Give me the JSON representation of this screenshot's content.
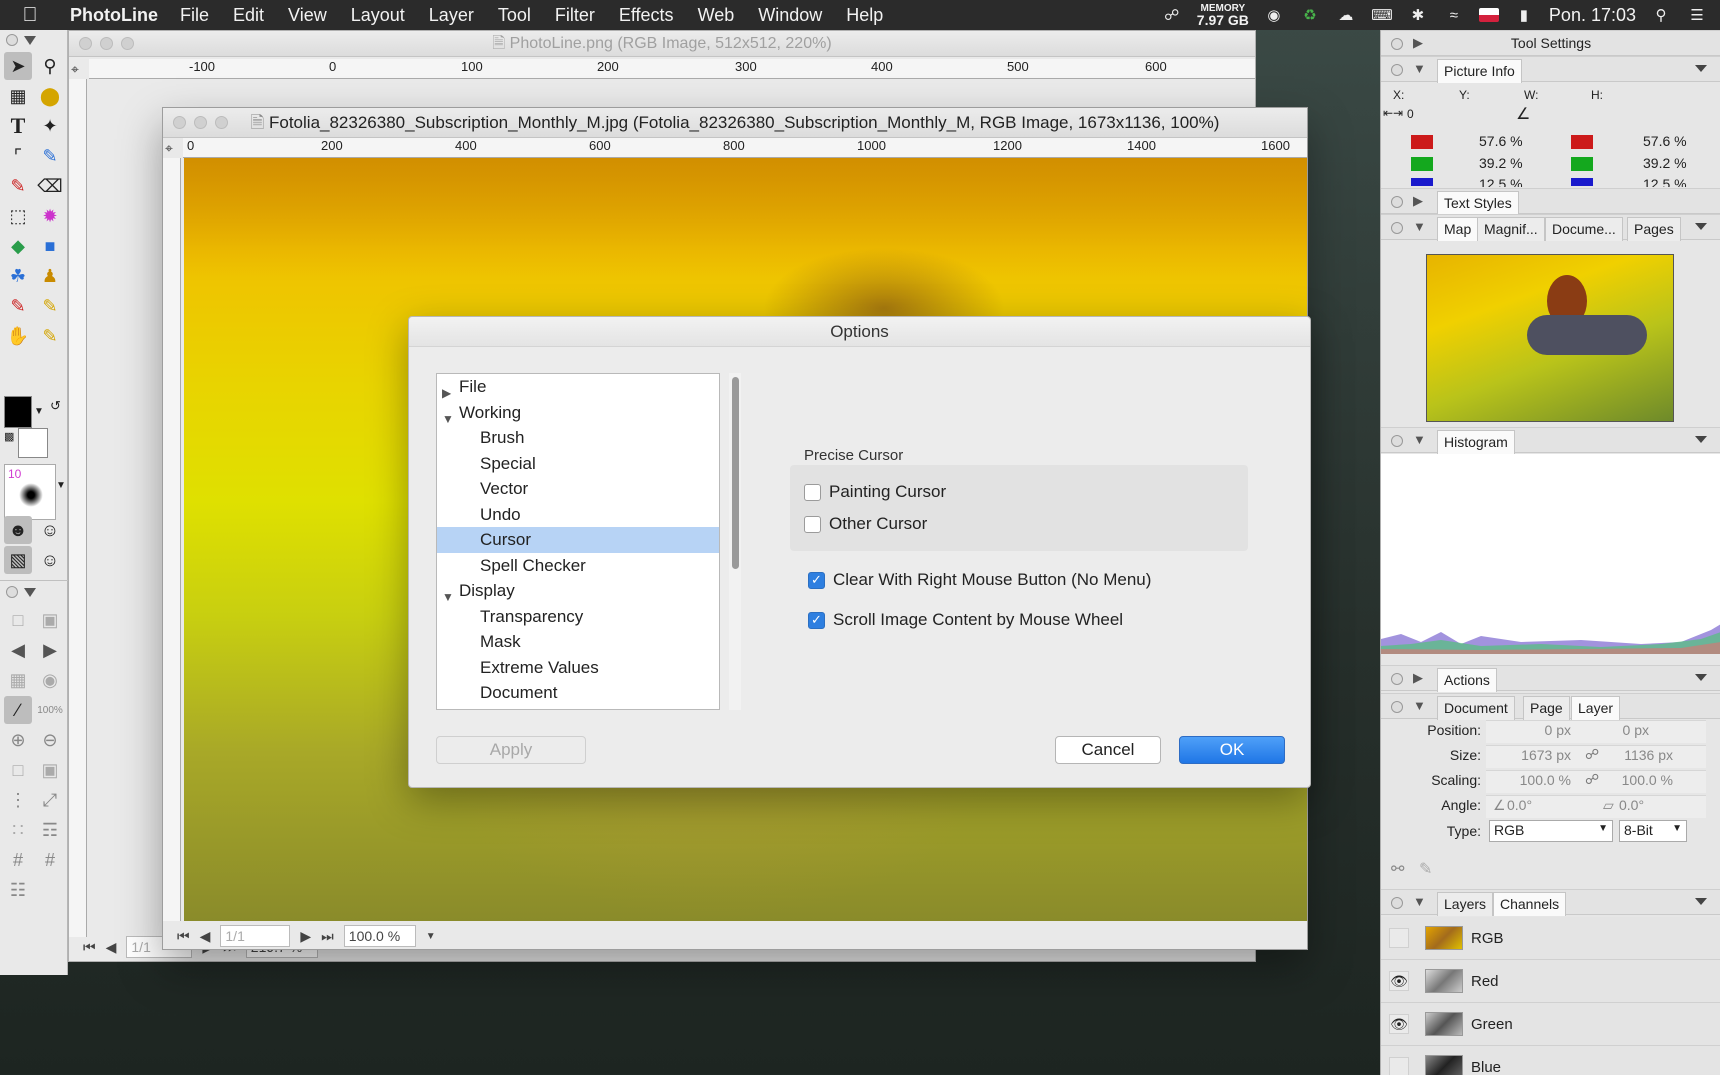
{
  "menubar": {
    "app_name": "PhotoLine",
    "items": [
      "File",
      "Edit",
      "View",
      "Layout",
      "Layer",
      "Tool",
      "Filter",
      "Effects",
      "Web",
      "Window",
      "Help"
    ],
    "memory_label": "MEMORY",
    "memory_value": "7.97 GB",
    "clock": "Pon. 17:03"
  },
  "main_window": {
    "title": "PhotoLine.png (RGB Image, 512x512, 220%)",
    "ruler_h_labels": [
      "-100",
      "0",
      "100",
      "200",
      "300",
      "400",
      "500",
      "600"
    ],
    "status_page": "1/1",
    "status_zoom": "219.7 %"
  },
  "image_window": {
    "title": "Fotolia_82326380_Subscription_Monthly_M.jpg (Fotolia_82326380_Subscription_Monthly_M, RGB Image, 1673x1136, 100%)",
    "ruler_h_labels": [
      "0",
      "200",
      "400",
      "600",
      "800",
      "1000",
      "1200",
      "1400",
      "1600"
    ],
    "status_page": "1/1",
    "status_zoom": "100.0 %"
  },
  "dialog": {
    "title": "Options",
    "tree": [
      {
        "label": "File",
        "level": 0,
        "expanded": false
      },
      {
        "label": "Working",
        "level": 0,
        "expanded": true
      },
      {
        "label": "Brush",
        "level": 1
      },
      {
        "label": "Special",
        "level": 1
      },
      {
        "label": "Vector",
        "level": 1
      },
      {
        "label": "Undo",
        "level": 1
      },
      {
        "label": "Cursor",
        "level": 1,
        "selected": true
      },
      {
        "label": "Spell Checker",
        "level": 1
      },
      {
        "label": "Display",
        "level": 0,
        "expanded": true
      },
      {
        "label": "Transparency",
        "level": 1
      },
      {
        "label": "Mask",
        "level": 1
      },
      {
        "label": "Extreme Values",
        "level": 1
      },
      {
        "label": "Document",
        "level": 1
      }
    ],
    "group_label": "Precise Cursor",
    "painting_cursor": {
      "label": "Painting Cursor",
      "checked": false
    },
    "other_cursor": {
      "label": "Other Cursor",
      "checked": false
    },
    "clear_right": {
      "label": "Clear With Right Mouse Button (No Menu)",
      "checked": true
    },
    "scroll_wheel": {
      "label": "Scroll Image Content by Mouse Wheel",
      "checked": true
    },
    "apply_label": "Apply",
    "cancel_label": "Cancel",
    "ok_label": "OK"
  },
  "right": {
    "tool_settings": "Tool Settings",
    "picture_info": "Picture Info",
    "info_labels": {
      "x": "X:",
      "y": "Y:",
      "w": "W:",
      "h": "H:",
      "zero": "0"
    },
    "rgb": [
      {
        "value": "57.6 %",
        "color": "#cc1a1a"
      },
      {
        "value": "39.2 %",
        "color": "#14a81e"
      },
      {
        "value": "12.5 %",
        "color": "#1a1acc"
      }
    ],
    "text_styles": "Text Styles",
    "nav_tabs": [
      "Map",
      "Magnif...",
      "Docume...",
      "Pages"
    ],
    "histogram": "Histogram",
    "actions": "Actions",
    "doc_tabs": [
      "Document",
      "Page",
      "Layer"
    ],
    "props": {
      "position_label": "Position:",
      "position_x": "0 px",
      "position_y": "0 px",
      "size_label": "Size:",
      "size_w": "1673 px",
      "size_h": "1136 px",
      "scaling_label": "Scaling:",
      "scaling_x": "100.0 %",
      "scaling_y": "100.0 %",
      "angle_label": "Angle:",
      "angle_a": "0.0°",
      "angle_b": "0.0°",
      "type_label": "Type:",
      "type_value": "RGB",
      "depth_value": "8-Bit"
    },
    "layer_tabs": [
      "Layers",
      "Channels"
    ],
    "channels": [
      {
        "name": "RGB",
        "visible": false
      },
      {
        "name": "Red",
        "visible": true
      },
      {
        "name": "Green",
        "visible": true
      },
      {
        "name": "Blue",
        "visible": false
      }
    ]
  }
}
